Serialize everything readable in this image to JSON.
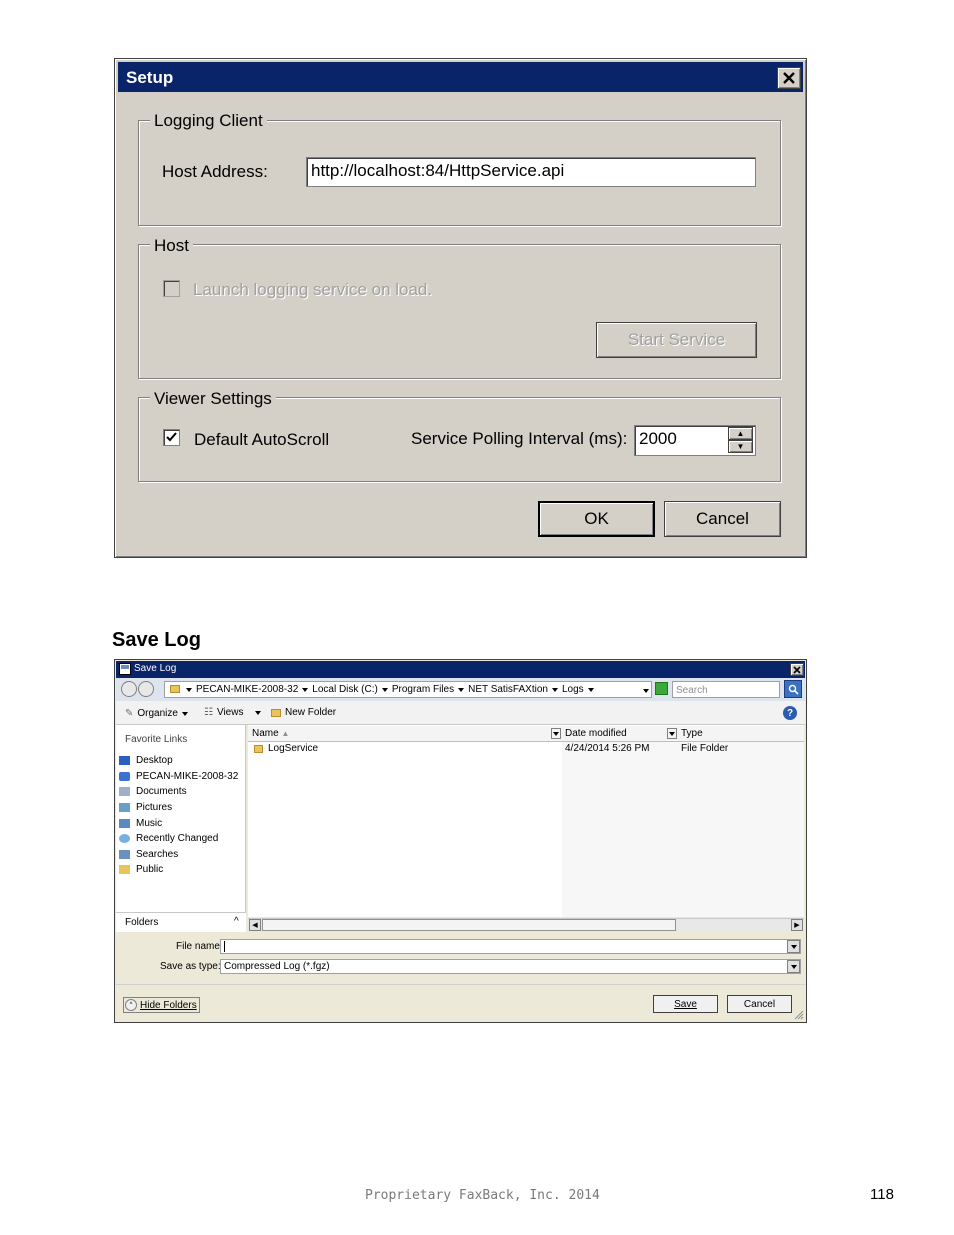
{
  "setup": {
    "title": "Setup",
    "logging_client": {
      "legend": "Logging Client",
      "host_label": "Host Address:",
      "host_value": "http://localhost:84/HttpService.api"
    },
    "host": {
      "legend": "Host",
      "launch_label": "Launch logging service on load.",
      "start_service": "Start Service"
    },
    "viewer": {
      "legend": "Viewer Settings",
      "autoscroll_label": "Default AutoScroll",
      "interval_label": "Service Polling Interval (ms):",
      "interval_value": "2000"
    },
    "ok": "OK",
    "cancel": "Cancel"
  },
  "section_heading": "Save Log",
  "savelog": {
    "title": "Save Log",
    "breadcrumb": [
      "PECAN-MIKE-2008-32",
      "Local Disk (C:)",
      "Program Files",
      "NET SatisFAXtion",
      "Logs"
    ],
    "search_placeholder": "Search",
    "toolbar": {
      "organize": "Organize",
      "views": "Views",
      "new_folder": "New Folder"
    },
    "favorite_links_label": "Favorite Links",
    "favorites": [
      "Desktop",
      "PECAN-MIKE-2008-32",
      "Documents",
      "Pictures",
      "Music",
      "Recently Changed",
      "Searches",
      "Public"
    ],
    "folders_label": "Folders",
    "columns": {
      "name": "Name",
      "date": "Date modified",
      "type": "Type"
    },
    "rows": [
      {
        "name": "LogService",
        "date": "4/24/2014 5:26 PM",
        "type": "File Folder"
      }
    ],
    "file_name_label": "File name:",
    "file_name_value": "",
    "save_type_label": "Save as type:",
    "save_type_value": "Compressed Log (*.fgz)",
    "hide_folders": "Hide Folders",
    "save": "Save",
    "cancel": "Cancel"
  },
  "footer": {
    "text": "Proprietary FaxBack, Inc. 2014",
    "page_number": "118"
  },
  "colors": {
    "titlebar": "#0a246a",
    "dialog_bg": "#d4d0c8"
  }
}
